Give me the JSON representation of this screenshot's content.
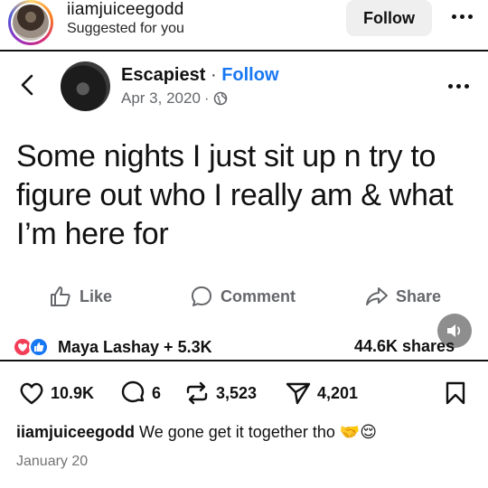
{
  "header": {
    "username": "iiamjuiceegodd",
    "subtitle": "Suggested for you",
    "follow_label": "Follow",
    "more_icon": "more-horizontal-icon"
  },
  "fb_post": {
    "page_name": "Escapiest",
    "separator": "·",
    "follow_label": "Follow",
    "date": "Apr 3, 2020",
    "date_sep": "·",
    "text": "Some nights I just sit up n try to figure out who I really am & what I’m here for",
    "actions": {
      "like": "Like",
      "comment": "Comment",
      "share": "Share"
    },
    "reactions_text": "Maya Lashay + 5.3K",
    "shares_text": "44.6K shares",
    "colors": {
      "link_blue": "#1877f2",
      "love_red": "#f33e58"
    }
  },
  "ig_actions": {
    "likes": "10.9K",
    "comments": "6",
    "reposts": "3,523",
    "shares": "4,201"
  },
  "caption": {
    "username": "iiamjuiceegodd",
    "text": "We gone get it together tho 🤝😌"
  },
  "post_date": "January 20"
}
